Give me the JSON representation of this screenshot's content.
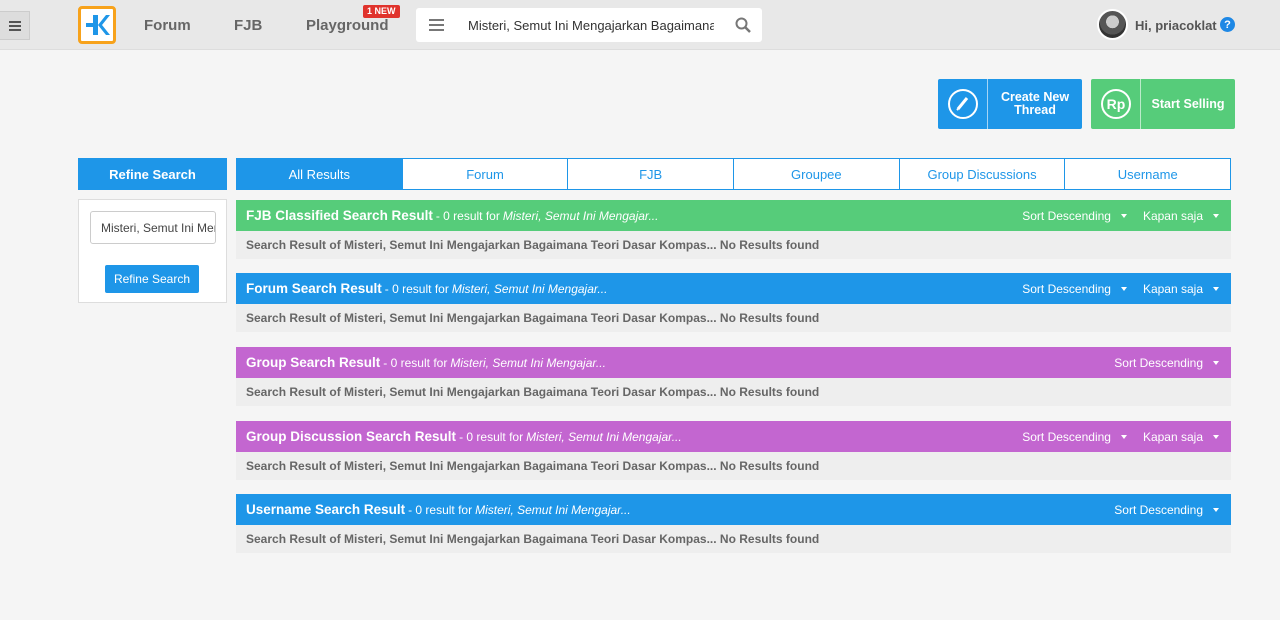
{
  "header": {
    "nav": [
      "Forum",
      "FJB",
      "Playground"
    ],
    "new_badge": "1 NEW",
    "search_value": "Misteri, Semut Ini Mengajarkan Bagaimana Teori Dasar Kompas...",
    "greeting": "Hi, priacoklat",
    "help_icon": "?"
  },
  "actions": {
    "create_thread": "Create New Thread",
    "start_selling": "Start Selling",
    "rp_icon": "Rp"
  },
  "refine": {
    "title": "Refine Search",
    "input_value": "Misteri, Semut Ini Mengajarkan",
    "button": "Refine Search"
  },
  "tabs": [
    "All Results",
    "Forum",
    "FJB",
    "Groupee",
    "Group Discussions",
    "Username"
  ],
  "colors": {
    "green": "#56cc7a",
    "blue": "#1e96e8",
    "purple": "#c366d0"
  },
  "sections": [
    {
      "title": "FJB Classified Search Result",
      "sub": "- 0 result for",
      "query": "Misteri, Semut Ini Mengajar...",
      "sort": "Sort Descending",
      "time": "Kapan saja",
      "body": "Search Result of Misteri, Semut Ini Mengajarkan Bagaimana Teori Dasar Kompas... No Results found"
    },
    {
      "title": "Forum Search Result",
      "sub": "- 0 result for",
      "query": "Misteri, Semut Ini Mengajar...",
      "sort": "Sort Descending",
      "time": "Kapan saja",
      "body": "Search Result of Misteri, Semut Ini Mengajarkan Bagaimana Teori Dasar Kompas... No Results found"
    },
    {
      "title": "Group Search Result",
      "sub": "- 0 result for",
      "query": "Misteri, Semut Ini Mengajar...",
      "sort": "Sort Descending",
      "body": "Search Result of Misteri, Semut Ini Mengajarkan Bagaimana Teori Dasar Kompas... No Results found"
    },
    {
      "title": "Group Discussion Search Result",
      "sub": "- 0 result for",
      "query": "Misteri, Semut Ini Mengajar...",
      "sort": "Sort Descending",
      "time": "Kapan saja",
      "body": "Search Result of Misteri, Semut Ini Mengajarkan Bagaimana Teori Dasar Kompas... No Results found"
    },
    {
      "title": "Username Search Result",
      "sub": "- 0 result for",
      "query": "Misteri, Semut Ini Mengajar...",
      "sort": "Sort Descending",
      "body": "Search Result of Misteri, Semut Ini Mengajarkan Bagaimana Teori Dasar Kompas... No Results found"
    }
  ]
}
